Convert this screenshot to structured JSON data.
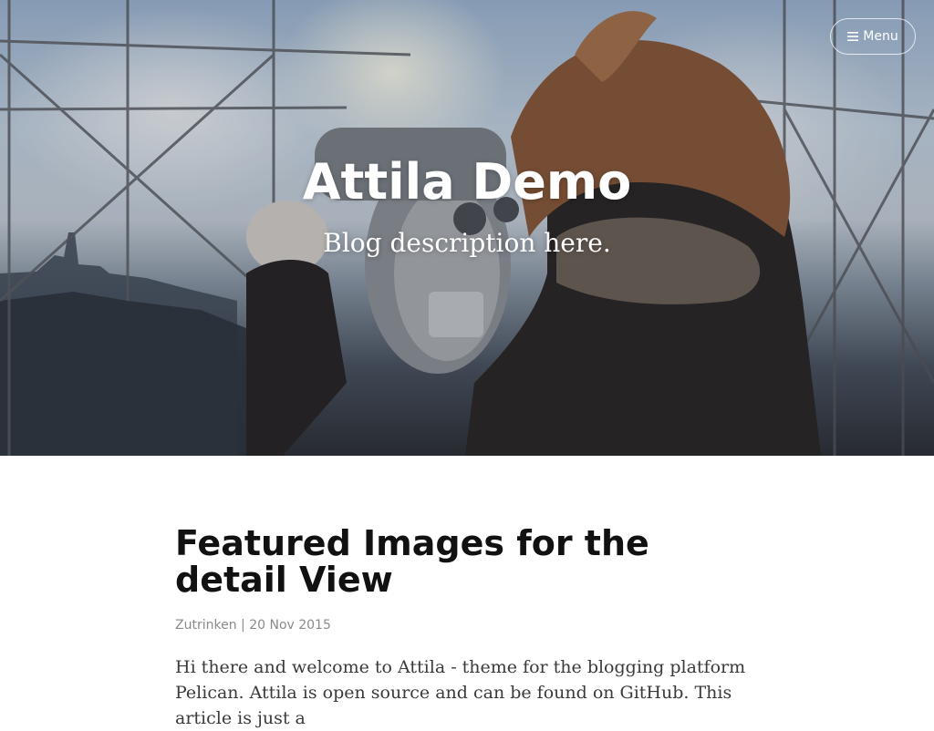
{
  "header": {
    "menu_label": "Menu",
    "menu_icon": "hamburger-icon",
    "blog_title": "Attila Demo",
    "blog_description": "Blog description here."
  },
  "post": {
    "title": "Featured Images for the detail View",
    "meta": {
      "author": "Zutrinken",
      "separator": "|",
      "date": "20 Nov 2015"
    },
    "excerpt": "Hi there and welcome to Attila - theme for the blogging platform Pelican. Attila is open source and can be found on GitHub. This article is just a"
  },
  "colors": {
    "title_text": "#111111",
    "meta_text": "#8a8a8a",
    "body_text": "#3a3a3a",
    "hero_text": "#ffffff"
  }
}
